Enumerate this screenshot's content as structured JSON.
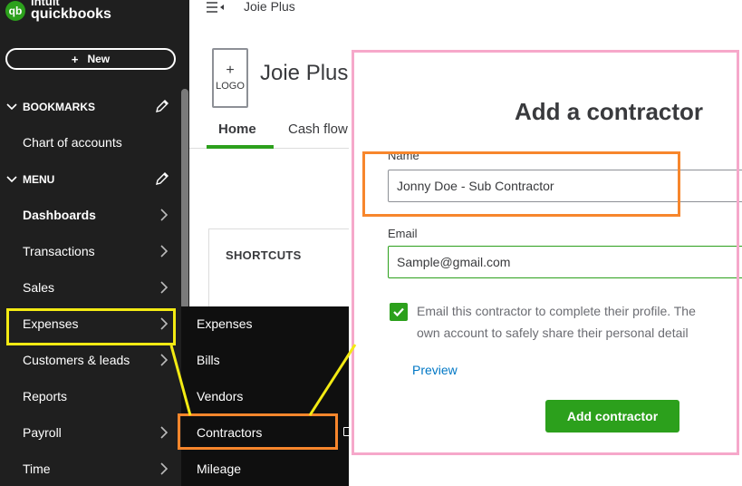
{
  "brand": {
    "line1": "intuit",
    "line2": "quickbooks",
    "mark": "qb"
  },
  "sidebar": {
    "new_label": "New",
    "bookmarks_label": "BOOKMARKS",
    "bookmarks": [
      {
        "label": "Chart of accounts"
      }
    ],
    "menu_label": "MENU",
    "items": [
      {
        "label": "Dashboards"
      },
      {
        "label": "Transactions"
      },
      {
        "label": "Sales"
      },
      {
        "label": "Expenses"
      },
      {
        "label": "Customers & leads"
      },
      {
        "label": "Reports"
      },
      {
        "label": "Payroll"
      },
      {
        "label": "Time"
      }
    ]
  },
  "submenu": {
    "items": [
      {
        "label": "Expenses"
      },
      {
        "label": "Bills"
      },
      {
        "label": "Vendors"
      },
      {
        "label": "Contractors"
      },
      {
        "label": "Mileage"
      }
    ]
  },
  "header": {
    "company": "Joie Plus"
  },
  "company_header": {
    "logo_plus": "+",
    "logo_label": "LOGO",
    "name": "Joie Plus"
  },
  "tabs": [
    {
      "label": "Home"
    },
    {
      "label": "Cash flow"
    }
  ],
  "shortcuts": {
    "label": "SHORTCUTS"
  },
  "panel": {
    "title": "Add a contractor",
    "name_label": "Name",
    "name_value": "Jonny Doe - Sub Contractor",
    "email_label": "Email",
    "email_value": "Sample@gmail.com",
    "checkbox_line1": "Email this contractor to complete their profile. The",
    "checkbox_line2": "own account to safely share their personal detail",
    "preview_link": "Preview",
    "submit_label": "Add contractor"
  },
  "colors": {
    "brand_green": "#2ca01c",
    "sidebar_bg": "#1f1f1f",
    "highlight_yellow": "#f3ea13",
    "highlight_orange": "#f7862c",
    "highlight_pink": "#f6a8ca",
    "link_blue": "#0077c5"
  }
}
